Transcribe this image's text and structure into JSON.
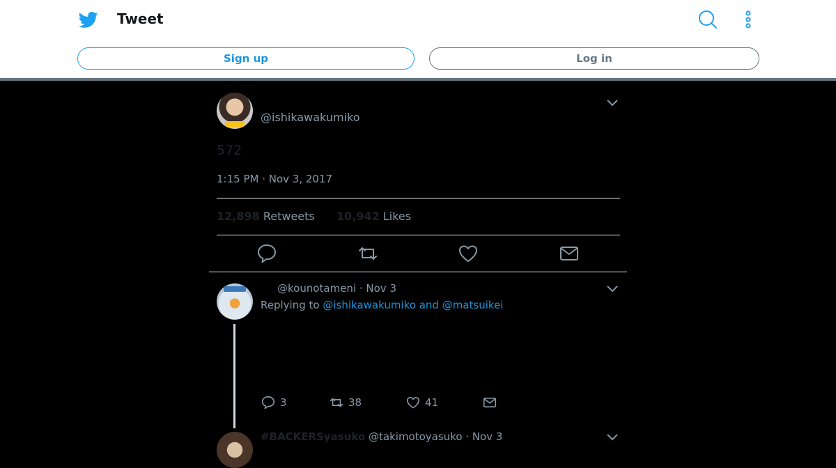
{
  "header": {
    "title": "Tweet",
    "signup_label": "Sign up",
    "login_label": "Log in",
    "accent": "#1da1f2"
  },
  "tweet": {
    "handle": "@ishikawakumiko",
    "text": "572",
    "timestamp": "1:15 PM · Nov 3, 2017",
    "retweets_count": "12,898",
    "retweets_label": "Retweets",
    "likes_count": "10,942",
    "likes_label": "Likes"
  },
  "reply": {
    "header": "@kounotameni · Nov 3",
    "replying_prefix": "Replying to",
    "replying_to": "@ishikawakumiko and @matsuikei",
    "reply_count": "3",
    "retweet_count": "38",
    "like_count": "41"
  },
  "next_reply": {
    "name": "#BACKERSyasuko",
    "rest": "@takimotoyasuko · Nov 3"
  }
}
